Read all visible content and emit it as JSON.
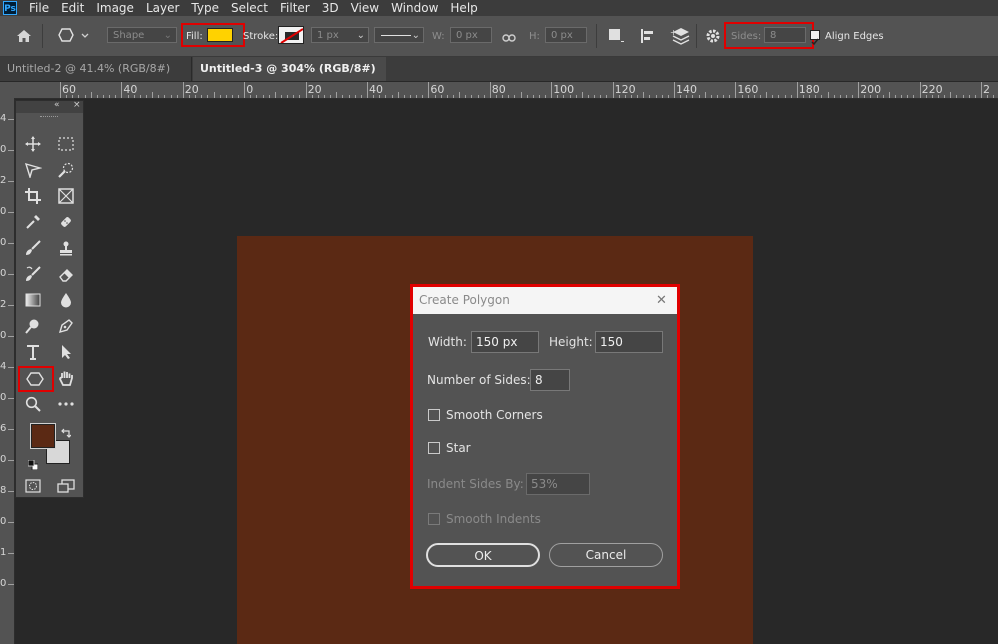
{
  "app": {
    "logo": "Ps"
  },
  "menu": [
    "File",
    "Edit",
    "Image",
    "Layer",
    "Type",
    "Select",
    "Filter",
    "3D",
    "View",
    "Window",
    "Help"
  ],
  "options": {
    "home_icon": "home-icon",
    "tool_mode": "Shape",
    "fill_label": "Fill:",
    "fill_color": "#ffd200",
    "stroke_label": "Stroke:",
    "stroke_width": "1 px",
    "w_label": "W:",
    "w_value": "0 px",
    "h_label": "H:",
    "h_value": "0 px",
    "sides_label": "Sides:",
    "sides_value": "8",
    "align_edges_label": "Align Edges",
    "align_edges_checked": true
  },
  "tabs": [
    {
      "label": "Untitled-2 @ 41.4% (RGB/8#) *",
      "close": "×",
      "active": false
    },
    {
      "label": "Untitled-3 @ 304% (RGB/8#) *",
      "close": "×",
      "active": true
    }
  ],
  "ruler": {
    "h_labels": [
      "60",
      "40",
      "20",
      "0",
      "20",
      "40",
      "60",
      "80",
      "100",
      "120",
      "140",
      "160",
      "180",
      "200",
      "220",
      "2"
    ],
    "v_labels": [
      "4",
      "0",
      "2",
      "0",
      "0",
      "0",
      "2",
      "0",
      "4",
      "0",
      "6",
      "0",
      "8",
      "0",
      "1",
      "0"
    ]
  },
  "toolbox": {
    "collapse": "«",
    "close": "×",
    "foreground_color": "#5b2914",
    "background_color": "#d8d8d8"
  },
  "canvas": {
    "artboard_color": "#5b2914"
  },
  "dialog": {
    "title": "Create Polygon",
    "close": "✕",
    "width_label": "Width:",
    "width_value": "150 px",
    "height_label": "Height:",
    "height_value": "150",
    "sides_label": "Number of Sides:",
    "sides_value": "8",
    "smooth_corners_label": "Smooth Corners",
    "star_label": "Star",
    "indent_label": "Indent Sides By:",
    "indent_value": "53%",
    "smooth_indents_label": "Smooth Indents",
    "ok_label": "OK",
    "cancel_label": "Cancel"
  }
}
